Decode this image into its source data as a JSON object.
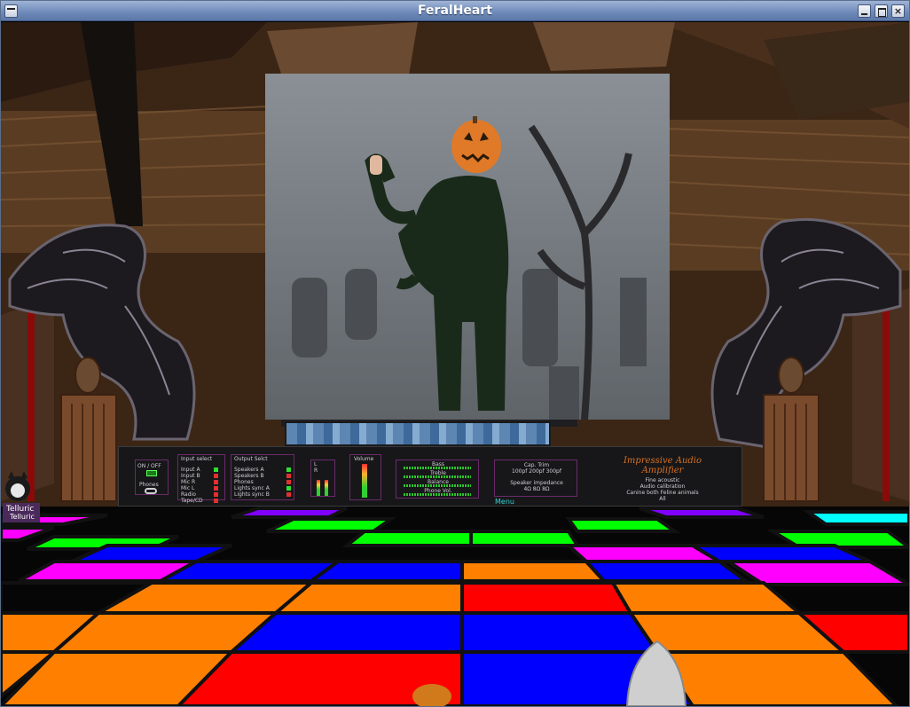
{
  "window": {
    "title": "FeralHeart"
  },
  "amplifier": {
    "power_label": "ON / OFF",
    "phones_label": "Phones",
    "input_select": {
      "title": "Input select",
      "items": [
        "Input A",
        "Input B",
        "Mic R",
        "Mic L",
        "Radio",
        "Tape/CD"
      ]
    },
    "output_select": {
      "title": "Output Selct",
      "items": [
        "Speakers A",
        "Speakers B",
        "Phones",
        "Lights sync A",
        "Lights sync B"
      ]
    },
    "meter_labels": "L R",
    "volume_label": "Volume",
    "tone_controls": [
      "Bass",
      "Treble",
      "Balance",
      "Phone Vol."
    ],
    "cap_trim": {
      "title": "Cap. Trim",
      "values": "100pf 200pf 300pf"
    },
    "speaker_impedance": {
      "title": "Speaker impedance",
      "values": "4Ω  8Ω  8Ω"
    },
    "brand": {
      "line1": "Impressive Audio",
      "line2": "Amplifier"
    },
    "calibration": {
      "line1": "Fine acoustic",
      "line2": "Audio calibration",
      "line3": "Canine   both   Feline   animals",
      "all": "All"
    },
    "menu_label": "Menu"
  },
  "player": {
    "name": "Telluric",
    "name2": "Telluric"
  },
  "colors": {
    "floor_red": "#ff0000",
    "floor_blue": "#0000ff",
    "floor_orange": "#ff7f00",
    "floor_green": "#00ff00",
    "floor_magenta": "#ff00ff",
    "floor_purple": "#8000ff",
    "floor_cyan": "#00ffff"
  }
}
